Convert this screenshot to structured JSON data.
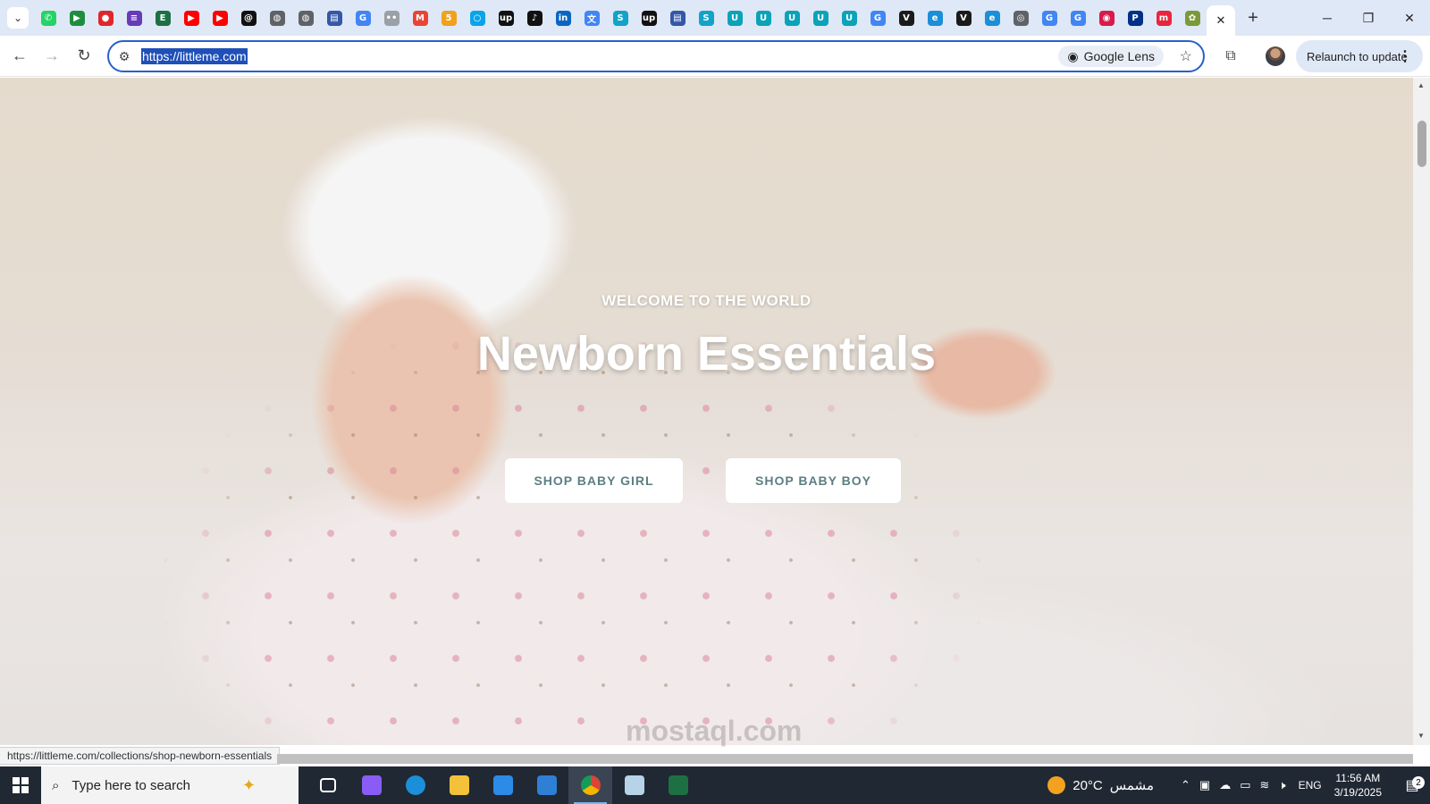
{
  "browser": {
    "pinned_tabs": [
      {
        "icon": "whatsapp-icon",
        "color": "#25d366",
        "glyph": "✆"
      },
      {
        "icon": "meet-icon",
        "color": "#1e8e3e",
        "glyph": "▶"
      },
      {
        "icon": "red-app-icon",
        "color": "#e0262b",
        "glyph": "●"
      },
      {
        "icon": "forms-icon",
        "color": "#673ab7",
        "glyph": "≡"
      },
      {
        "icon": "excel-icon",
        "color": "#1d7044",
        "glyph": "E"
      },
      {
        "icon": "youtube-icon",
        "color": "#ff0000",
        "glyph": "▶"
      },
      {
        "icon": "youtube-icon",
        "color": "#ff0000",
        "glyph": "▶"
      },
      {
        "icon": "threads-icon",
        "color": "#111111",
        "glyph": "@"
      },
      {
        "icon": "globe-icon",
        "color": "#5f6368",
        "glyph": "◍"
      },
      {
        "icon": "globe-icon",
        "color": "#5f6368",
        "glyph": "◍"
      },
      {
        "icon": "doc-icon",
        "color": "#3557a8",
        "glyph": "▤"
      },
      {
        "icon": "google-icon",
        "color": "#4285f4",
        "glyph": "G"
      },
      {
        "icon": "dots-icon",
        "color": "#9aa0a6",
        "glyph": "••"
      },
      {
        "icon": "gmail-icon",
        "color": "#ea4335",
        "glyph": "M"
      },
      {
        "icon": "five-icon",
        "color": "#f1a11a",
        "glyph": "5"
      },
      {
        "icon": "circle-blue-icon",
        "color": "#0aa4e8",
        "glyph": "○"
      },
      {
        "icon": "upwork-icon",
        "color": "#111111",
        "glyph": "up"
      },
      {
        "icon": "tiktok-icon",
        "color": "#111111",
        "glyph": "♪"
      },
      {
        "icon": "linkedin-icon",
        "color": "#0a66c2",
        "glyph": "in"
      },
      {
        "icon": "translate-icon",
        "color": "#4285f4",
        "glyph": "文"
      },
      {
        "icon": "s-app-icon",
        "color": "#12a3c7",
        "glyph": "S"
      },
      {
        "icon": "upwork-icon",
        "color": "#111111",
        "glyph": "up"
      },
      {
        "icon": "doc-icon",
        "color": "#3557a8",
        "glyph": "▤"
      },
      {
        "icon": "s-app-icon",
        "color": "#12a3c7",
        "glyph": "S"
      },
      {
        "icon": "u-app-icon",
        "color": "#0aa3b8",
        "glyph": "U"
      },
      {
        "icon": "u-app-icon",
        "color": "#0aa3b8",
        "glyph": "U"
      },
      {
        "icon": "u-app-icon",
        "color": "#0aa3b8",
        "glyph": "U"
      },
      {
        "icon": "u-app-icon",
        "color": "#0aa3b8",
        "glyph": "U"
      },
      {
        "icon": "u-app-icon",
        "color": "#0aa3b8",
        "glyph": "U"
      },
      {
        "icon": "google-icon",
        "color": "#4285f4",
        "glyph": "G"
      },
      {
        "icon": "v-app-icon",
        "color": "#1a1a1a",
        "glyph": "V"
      },
      {
        "icon": "edge-icon",
        "color": "#1b8fd8",
        "glyph": "e"
      },
      {
        "icon": "v-app-icon",
        "color": "#1a1a1a",
        "glyph": "V"
      },
      {
        "icon": "edge-icon",
        "color": "#1b8fd8",
        "glyph": "e"
      },
      {
        "icon": "chrome-icon",
        "color": "#5f6368",
        "glyph": "◎"
      },
      {
        "icon": "google-icon",
        "color": "#4285f4",
        "glyph": "G"
      },
      {
        "icon": "google-icon",
        "color": "#4285f4",
        "glyph": "G"
      },
      {
        "icon": "red-circle-icon",
        "color": "#d81b4a",
        "glyph": "◉"
      },
      {
        "icon": "paypal-icon",
        "color": "#003087",
        "glyph": "P"
      },
      {
        "icon": "m-app-icon",
        "color": "#e8253f",
        "glyph": "m"
      },
      {
        "icon": "game-icon",
        "color": "#7a9a3a",
        "glyph": "✿"
      }
    ],
    "address_url": "https://littleme.com",
    "lens_label": "Google Lens",
    "relaunch_label": "Relaunch to update",
    "status_url": "https://littleme.com/collections/shop-newborn-essentials"
  },
  "page": {
    "kicker": "WELCOME TO THE WORLD",
    "title": "Newborn Essentials",
    "cta_girl": "SHOP BABY GIRL",
    "cta_boy": "SHOP BABY BOY",
    "cta_text_color": "#5c7f83"
  },
  "watermark": "mostaql.com",
  "taskbar": {
    "search_placeholder": "Type here to search",
    "apps": [
      {
        "icon": "task-view-icon",
        "color": "#ffffff"
      },
      {
        "icon": "copilot-icon",
        "color": "#8a5cf6"
      },
      {
        "icon": "edge-icon",
        "color": "#1b8fd8"
      },
      {
        "icon": "file-explorer-icon",
        "color": "#f3c13a"
      },
      {
        "icon": "store-icon",
        "color": "#2b8be6"
      },
      {
        "icon": "mail-icon",
        "color": "#2f7fd6"
      },
      {
        "icon": "chrome-icon",
        "color": "#dd4b3e",
        "active": true
      },
      {
        "icon": "paint-icon",
        "color": "#b7d3e8"
      },
      {
        "icon": "excel-icon",
        "color": "#1d7044"
      }
    ],
    "weather_temp": "20°C",
    "weather_text": "مشمس",
    "language": "ENG",
    "time": "11:56 AM",
    "date": "3/19/2025",
    "notification_count": "2"
  }
}
